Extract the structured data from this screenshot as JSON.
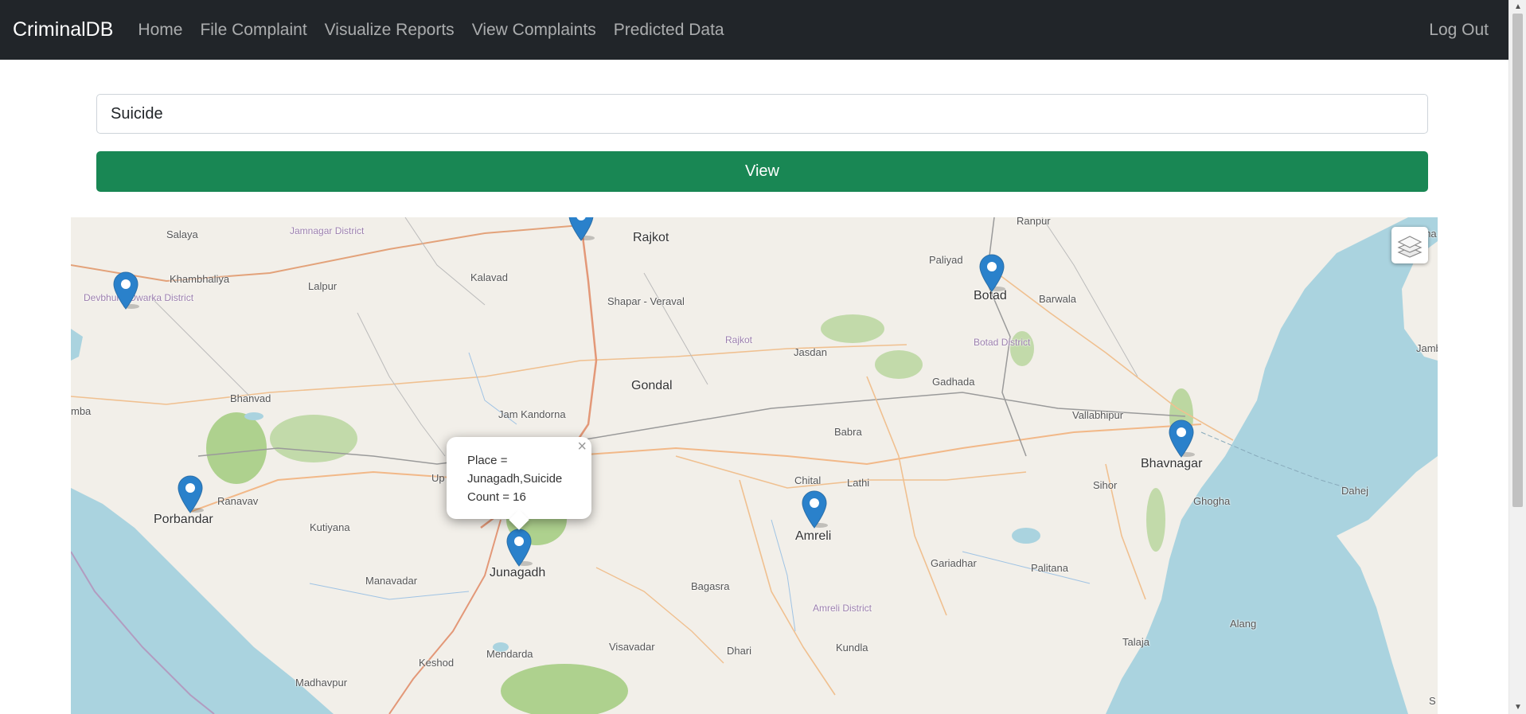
{
  "navbar": {
    "brand": "CriminalDB",
    "links": [
      "Home",
      "File Complaint",
      "Visualize Reports",
      "View Complaints",
      "Predicted Data"
    ],
    "logout": "Log Out"
  },
  "search": {
    "value": "Suicide"
  },
  "view_button": "View",
  "map": {
    "labels": {
      "salaya": "Salaya",
      "jamnagar_district": "Jamnagar District",
      "rajkot": "Rajkot",
      "ranpur": "Ranpur",
      "khambha": "Khambha",
      "khambhaliya": "Khambhaliya",
      "lalpur": "Lalpur",
      "kalavad": "Kalavad",
      "paliyad": "Paliyad",
      "botad": "Botad",
      "barwala": "Barwala",
      "devbhumi": "Devbhumi Dwarka District",
      "shapar": "Shapar - Veraval",
      "rajkot_district": "Rajkot",
      "jasdan": "Jasdan",
      "botad_district": "Botad District",
      "jamb": "Jamb",
      "gondal": "Gondal",
      "gadhada": "Gadhada",
      "bhanvad": "Bhanvad",
      "jam_kandorna": "Jam Kandorna",
      "vallabhipur": "Vallabhipur",
      "babra": "Babra",
      "mba": "mba",
      "bhavnagar": "Bhavnagar",
      "chital": "Chital",
      "lathi": "Lathi",
      "sihor": "Sihor",
      "porbandar": "Porbandar",
      "ghogha": "Ghogha",
      "dahej": "Dahej",
      "ranavav": "Ranavav",
      "kutiyana": "Kutiyana",
      "amreli": "Amreli",
      "junagadh": "Junagadh",
      "gariadhar": "Gariadhar",
      "palitana": "Palitana",
      "manavadar": "Manavadar",
      "bagasra": "Bagasra",
      "alang": "Alang",
      "amreli_district": "Amreli District",
      "talaja": "Talaja",
      "kundla": "Kundla",
      "mendarda": "Mendarda",
      "visavadar": "Visavadar",
      "dhari": "Dhari",
      "keshod": "Keshod",
      "madhavpur": "Madhavpur",
      "up": "Up",
      "s": "S"
    },
    "popup": {
      "line1": "Place =",
      "line2": "Junagadh,Suicide",
      "line3": "Count = 16"
    }
  },
  "colors": {
    "navbar": "#212529",
    "button": "#198754",
    "marker": "#2a81cb",
    "water": "#aad3df",
    "park": "#aed18e"
  }
}
